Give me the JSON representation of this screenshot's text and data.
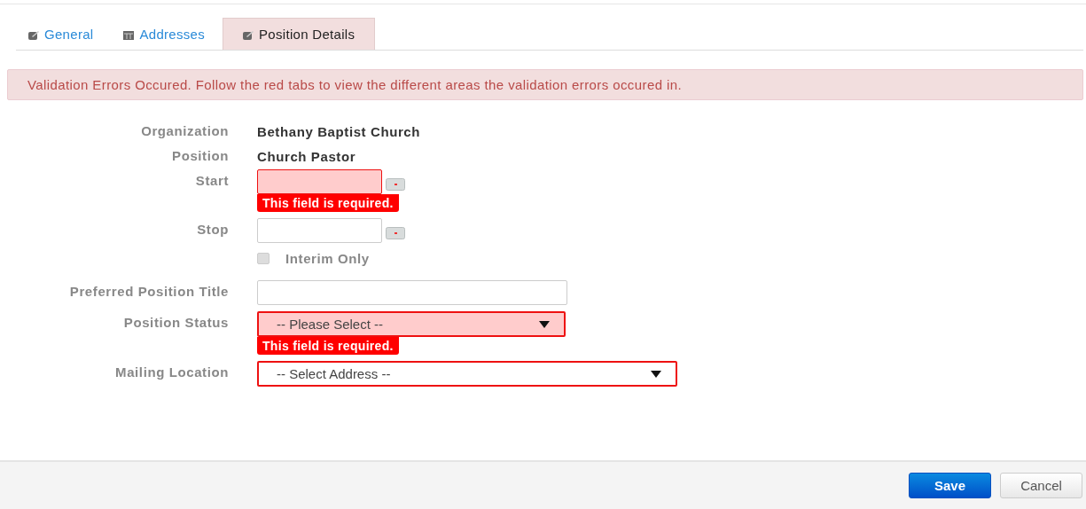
{
  "tabs": [
    {
      "label": "General",
      "kind": "edit",
      "selected": false
    },
    {
      "label": "Addresses",
      "kind": "table",
      "selected": false
    },
    {
      "label": "Position Details",
      "kind": "edit",
      "selected": true
    }
  ],
  "alert": "Validation Errors Occured. Follow the red tabs to view the different areas the validation errors occured in.",
  "fields": [
    {
      "kind": "static",
      "label": "Organization",
      "value": "Bethany Baptist Church"
    },
    {
      "kind": "static",
      "label": "Position",
      "value": "Church Pastor"
    },
    {
      "kind": "date",
      "label": "Start",
      "invalid": true,
      "error": "This field is required."
    },
    {
      "kind": "date",
      "label": "Stop",
      "invalid": false
    },
    {
      "kind": "checkbox",
      "label": "Interim Only",
      "checked": false
    },
    {
      "kind": "text",
      "label": "Preferred Position Title",
      "invalid": false
    },
    {
      "kind": "select",
      "label": "Position Status",
      "value": "-- Please Select --",
      "invalid": true,
      "error": "This field is required."
    },
    {
      "kind": "longselect",
      "label": "Mailing Location",
      "value": "-- Select Address --",
      "invalid": true
    }
  ],
  "buttons": [
    {
      "label": "Save",
      "kind": "primary"
    },
    {
      "label": "Cancel",
      "kind": "default"
    }
  ]
}
